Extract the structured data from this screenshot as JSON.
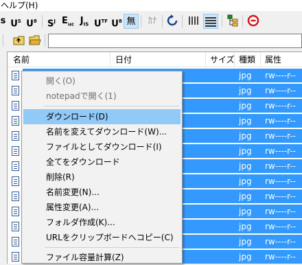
{
  "menubar": {
    "help": "ヘルプ(H)"
  },
  "toolbar": {
    "buttons": [
      {
        "main": "s",
        "sup": "",
        "sub": ""
      },
      {
        "main": "U",
        "sup": "S",
        "sub": ""
      },
      {
        "main": "U",
        "sup": "",
        "sub": ""
      },
      {
        "main": "S",
        "sup": "J",
        "sub": ""
      },
      {
        "main": "E",
        "sup": "",
        "sub": "uc"
      },
      {
        "main": "J",
        "sup": "",
        "sub": "IS"
      },
      {
        "main": "U",
        "sup": "TF",
        "sub": "8"
      },
      {
        "main": "U",
        "sup": "",
        "sub": ""
      },
      {
        "main": "無",
        "sup": "",
        "sub": ""
      },
      {
        "main": "ｶﾅ",
        "sup": "",
        "sub": ""
      }
    ],
    "icons": [
      "refresh-icon",
      "list-view-icon",
      "detail-view-icon",
      "tree-icon",
      "stop-icon"
    ]
  },
  "path": {
    "value": ""
  },
  "columns": {
    "name": "名前",
    "date": "日付",
    "size": "サイズ",
    "type": "種類",
    "attr": "属性"
  },
  "files": [
    {
      "ext": "jpg",
      "attr": "rw----r--"
    },
    {
      "ext": "jpg",
      "attr": "rw----r--"
    },
    {
      "ext": "jpg",
      "attr": "rw----r--"
    },
    {
      "ext": "jpg",
      "attr": "rw----r--"
    },
    {
      "ext": "jpg",
      "attr": "rw----r--"
    },
    {
      "ext": "jpg",
      "attr": "rw----r--"
    },
    {
      "ext": "jpg",
      "attr": "rw----r--"
    },
    {
      "ext": "jpg",
      "attr": "rw----r--"
    },
    {
      "ext": "jpg",
      "attr": "rw----r--"
    },
    {
      "ext": "jpg",
      "attr": "rw----r--"
    },
    {
      "ext": "jpg",
      "attr": "rw----r--"
    },
    {
      "ext": "jpg",
      "attr": "rw----r--"
    },
    {
      "ext": "jpg",
      "attr": "rw----r--"
    }
  ],
  "context_menu": {
    "open": "開く(O)",
    "open_notepad": "notepadで開く(1)",
    "download": "ダウンロード(D)",
    "rename_download": "名前を変えてダウンロード(W)...",
    "download_as_file": "ファイルとしてダウンロード(I)",
    "download_all": "全てをダウンロード",
    "delete": "削除(R)",
    "rename": "名前変更(N)...",
    "change_attr": "属性変更(A)...",
    "mkdir": "フォルダ作成(K)...",
    "copy_url": "URLをクリップボードへコピー(C)",
    "calc_size": "ファイル容量計算(Z)"
  },
  "colors": {
    "selection": "#3399ff",
    "menu_highlight": "#91c9f7"
  }
}
